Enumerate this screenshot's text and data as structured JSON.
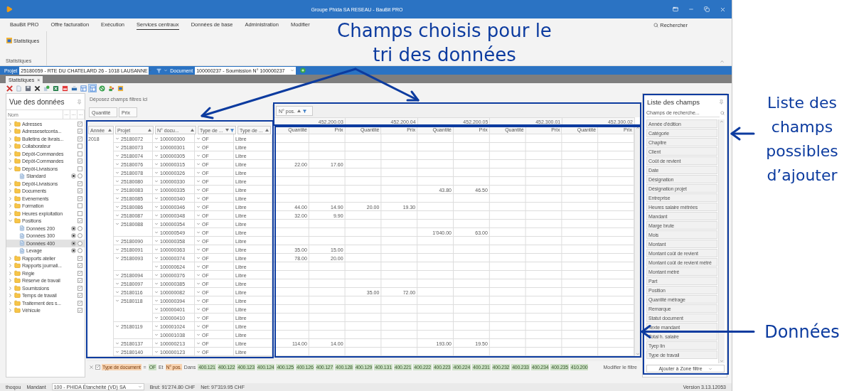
{
  "window": {
    "title": "Groupe Phida SA RESEAU - BauBit PRO"
  },
  "menu": [
    {
      "label": "BauBit PRO",
      "selected": false
    },
    {
      "label": "Offre facturation",
      "selected": false
    },
    {
      "label": "Exécution",
      "selected": false
    },
    {
      "label": "Services centraux",
      "selected": true
    },
    {
      "label": "Données de base",
      "selected": false
    },
    {
      "label": "Administration",
      "selected": false
    },
    {
      "label": "Modifier",
      "selected": false
    }
  ],
  "search": "Rechercher",
  "ribbon": {
    "button": "Statistiques",
    "group": "Statistiques"
  },
  "context_bar": {
    "project_label": "Projet",
    "project": "25180059 - RTE DU CHATELARD 26 - 1018 LAUSANNE",
    "document_label": "Document",
    "document": "100000237 - Soumission N° 100000237"
  },
  "doc_tab": {
    "label": "Statistiques",
    "close": "×"
  },
  "toolbar": [
    {
      "kind": "delete",
      "selected": false
    },
    {
      "kind": "document",
      "selected": false
    },
    {
      "kind": "save",
      "selected": false
    },
    {
      "kind": "close",
      "selected": false
    },
    {
      "kind": "add",
      "selected": false
    },
    {
      "kind": "spreadsheet",
      "selected": false
    },
    {
      "kind": "pdf",
      "selected": false
    },
    {
      "kind": "print",
      "selected": false
    },
    {
      "kind": "layout",
      "selected": false
    },
    {
      "kind": "layout",
      "selected": true
    },
    {
      "kind": "refresh",
      "selected": false
    },
    {
      "kind": "users",
      "selected": false
    },
    {
      "kind": "chart",
      "selected": false
    }
  ],
  "data_view": {
    "title": "Vue des données",
    "column": "Nom",
    "column_buttons": [
      "...",
      "...",
      "..."
    ],
    "items": [
      {
        "label": "Adresses",
        "checked": true,
        "expanded": false
      },
      {
        "label": "Adressesetconta...",
        "checked": true,
        "expanded": false
      },
      {
        "label": "Bulletins de livrais...",
        "checked": true,
        "expanded": false
      },
      {
        "label": "Collaborateur",
        "checked": false,
        "expanded": false
      },
      {
        "label": "Dépôt-Commandes",
        "checked": false,
        "expanded": false
      },
      {
        "label": "Dépôt-Commandes",
        "checked": true,
        "expanded": false
      },
      {
        "label": "Dépôt-Livraisons",
        "checked": false,
        "expanded": true,
        "children": [
          {
            "label": "Standard",
            "selected": false,
            "default": true
          }
        ]
      },
      {
        "label": "Dépôt-Livraisons",
        "checked": true,
        "expanded": false
      },
      {
        "label": "Documents",
        "checked": true,
        "expanded": false
      },
      {
        "label": "Evénements",
        "checked": true,
        "expanded": false
      },
      {
        "label": "Formation",
        "checked": false,
        "expanded": false
      },
      {
        "label": "Heures exploitation",
        "checked": false,
        "expanded": false
      },
      {
        "label": "Positions",
        "checked": true,
        "expanded": true,
        "children": [
          {
            "label": "Données 200",
            "selected": false,
            "default": true
          },
          {
            "label": "Données 300",
            "selected": false,
            "default": true
          },
          {
            "label": "Données 400",
            "selected": true,
            "default": true
          },
          {
            "label": "Levage",
            "selected": false,
            "default": true
          }
        ]
      },
      {
        "label": "Rapports atelier",
        "checked": true,
        "expanded": false
      },
      {
        "label": "Rapports journali...",
        "checked": true,
        "expanded": false
      },
      {
        "label": "Régie",
        "checked": true,
        "expanded": false
      },
      {
        "label": "Réserve de travail",
        "checked": true,
        "expanded": false
      },
      {
        "label": "Soumissions",
        "checked": true,
        "expanded": false
      },
      {
        "label": "Temps de travail",
        "checked": true,
        "expanded": false
      },
      {
        "label": "Traitement des s...",
        "checked": true,
        "expanded": false
      },
      {
        "label": "Véhicule",
        "checked": true,
        "expanded": false
      }
    ]
  },
  "pivot": {
    "filter_hint": "Déposez champs filtres ici",
    "data_fields": [
      "Quantité",
      "Prix"
    ],
    "row_fields": [
      {
        "label": "Année",
        "descending": false,
        "filtered": false
      },
      {
        "label": "Projet",
        "descending": false,
        "filtered": false
      },
      {
        "label": "N° docu...",
        "descending": false,
        "filtered": false
      },
      {
        "label": "Type de ...",
        "descending": true,
        "filtered": true
      },
      {
        "label": "Type de ...",
        "descending": false,
        "filtered": false
      }
    ],
    "column_field": {
      "label": "N° pos.",
      "descending": false,
      "filtered": true
    },
    "column_groups": [
      {
        "label": "452.200.03",
        "measures": [
          "Quantité",
          "Prix"
        ]
      },
      {
        "label": "452.200.04",
        "measures": [
          "Quantité",
          "Prix"
        ]
      },
      {
        "label": "452.200.05",
        "measures": [
          "Quantité",
          "Prix"
        ]
      },
      {
        "label": "452.300.01",
        "measures": [
          "Quantité",
          "Prix"
        ]
      },
      {
        "label": "452.300.02",
        "measures": [
          "Quantité",
          "Prix"
        ]
      }
    ],
    "rows": [
      {
        "year": "2018",
        "project": "25180072",
        "document": "100000300",
        "type": "OF",
        "kind": "Libre"
      },
      {
        "project": "25180073",
        "document": "100000301",
        "type": "OF",
        "kind": "Libre"
      },
      {
        "project": "25180074",
        "document": "100000305",
        "type": "OF",
        "kind": "Libre"
      },
      {
        "project": "25180076",
        "document": "100000315",
        "type": "OF",
        "kind": "Libre",
        "values": {
          "col_1": "22.00",
          "col_2": "17.60"
        }
      },
      {
        "project": "25180078",
        "document": "100000326",
        "type": "OF",
        "kind": "Libre"
      },
      {
        "project": "25180080",
        "document": "100000330",
        "type": "OF",
        "kind": "Libre"
      },
      {
        "project": "25180083",
        "document": "100000335",
        "type": "OF",
        "kind": "Libre",
        "values": {
          "col_5": "43.80",
          "col_6": "46.50"
        }
      },
      {
        "project": "25180085",
        "document": "100000340",
        "type": "OF",
        "kind": "Libre"
      },
      {
        "project": "25180086",
        "document": "100000346",
        "type": "OF",
        "kind": "Libre",
        "values": {
          "col_1": "44.00",
          "col_2": "14.90",
          "col_3": "20.00",
          "col_4": "19.30"
        }
      },
      {
        "project": "25180087",
        "document": "100000348",
        "type": "OF",
        "kind": "Libre",
        "values": {
          "col_1": "32.00",
          "col_2": "9.90"
        }
      },
      {
        "project": "25180088",
        "document": "100000354",
        "type": "OF",
        "kind": "Libre"
      },
      {
        "document": "100000549",
        "type": "OF",
        "kind": "Libre",
        "values": {
          "col_5": "1'040.00",
          "col_6": "63.00"
        }
      },
      {
        "project": "25180090",
        "document": "100000358",
        "type": "OF",
        "kind": "Libre"
      },
      {
        "project": "25180091",
        "document": "100000363",
        "type": "OF",
        "kind": "Libre",
        "values": {
          "col_1": "35.00",
          "col_2": "15.00"
        }
      },
      {
        "project": "25180093",
        "document": "100000374",
        "type": "OF",
        "kind": "Libre",
        "values": {
          "col_1": "78.00",
          "col_2": "20.00"
        }
      },
      {
        "document": "100000624",
        "type": "OF",
        "kind": "Libre"
      },
      {
        "project": "25180094",
        "document": "100000376",
        "type": "OF",
        "kind": "Libre"
      },
      {
        "project": "25180097",
        "document": "100000385",
        "type": "OF",
        "kind": "Libre"
      },
      {
        "project": "25180116",
        "document": "100000082",
        "type": "OF",
        "kind": "Libre",
        "values": {
          "col_3": "35.00",
          "col_4": "72.00"
        }
      },
      {
        "project": "25180118",
        "document": "100000394",
        "type": "OF",
        "kind": "Libre"
      },
      {
        "document": "100000401",
        "type": "OF",
        "kind": "Libre"
      },
      {
        "document": "100000410",
        "type": "OF",
        "kind": "Libre"
      },
      {
        "project": "25180119",
        "document": "100001024",
        "type": "OF",
        "kind": "Libre"
      },
      {
        "document": "100001038",
        "type": "OF",
        "kind": "Libre"
      },
      {
        "project": "25180137",
        "document": "100000213",
        "type": "OF",
        "kind": "Libre",
        "values": {
          "col_1": "114.00",
          "col_2": "14.00",
          "col_5": "193.00",
          "col_6": "19.50"
        }
      },
      {
        "project": "25180140",
        "document": "100000123",
        "type": "OF",
        "kind": "Libre"
      }
    ]
  },
  "filter_bar": {
    "enabled": true,
    "field1": "Type de document",
    "operator1": "=",
    "value1": "OF",
    "joiner": "Et",
    "field2": "N° pos.",
    "operator2": "Dans",
    "values": [
      "400.121",
      "400.122",
      "400.123",
      "400.124",
      "400.125",
      "400.126",
      "400.127",
      "400.128",
      "400.129",
      "400.131",
      "400.221",
      "400.222",
      "400.223",
      "400.224",
      "400.231",
      "400.232",
      "400.233",
      "400.234",
      "400.235",
      "410.200"
    ],
    "edit": "Modifier le filtre"
  },
  "field_list": {
    "title": "Liste des champs",
    "placeholder": "Champs de recherche...",
    "fields": [
      "Année d'édition",
      "Catégorie",
      "Chapitre",
      "Client",
      "Coût de revient",
      "Date",
      "Désignation",
      "Désignation projet",
      "Entreprise",
      "Heures salaire métrées",
      "Mandant",
      "Marge brute",
      "Mois",
      "Montant",
      "Montant coût de revient",
      "Montant coût de revient métré",
      "Montant métré",
      "Part",
      "Position",
      "Quantité métrage",
      "Remarque",
      "Statut document",
      "Texte mandant",
      "Total h. salaire",
      "Tyep lin",
      "Type de travail"
    ],
    "add_button": "Ajouter à Zone filtre"
  },
  "status_bar": {
    "user": "thoqou",
    "client_label": "Mandant",
    "client": "100 - PHIDA Étanchéité (VD) SA",
    "gross": "Brut: 91'274.80 CHF",
    "net": "Net: 97'319.95 CHF",
    "version": "Version 3.13.12053"
  },
  "annotations": {
    "sort_fields": "Champs choisis pour le tri des données",
    "field_list": "Liste des champs possibles d’ajouter",
    "data": "Données"
  }
}
